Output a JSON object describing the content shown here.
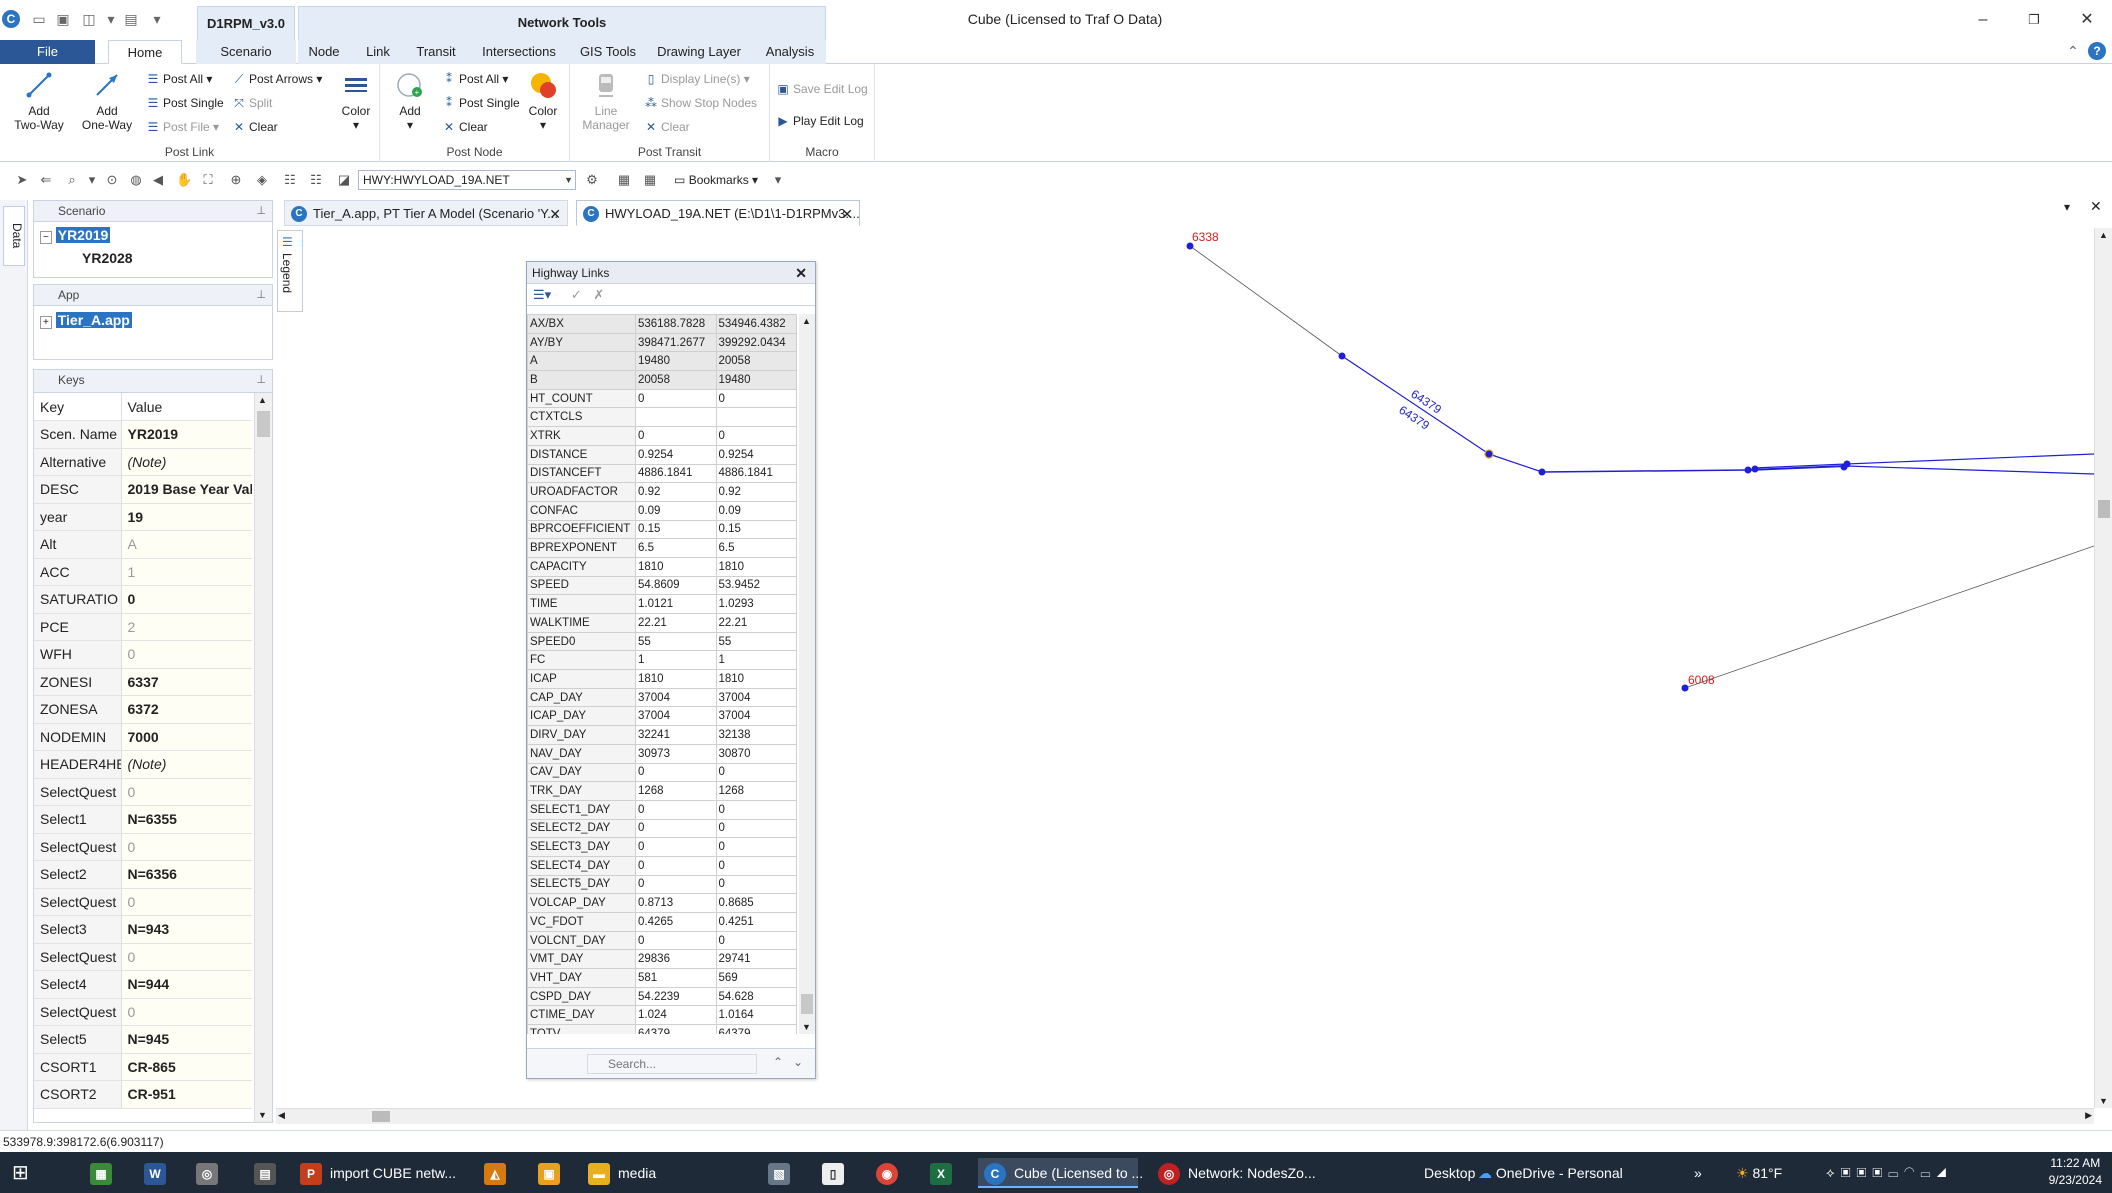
{
  "titlebar": {
    "context_tab": "D1RPM_v3.0",
    "network_tools": "Network Tools",
    "window_title": "Cube (Licensed to Traf O Data)"
  },
  "ribbon_tabs": [
    "File",
    "Home",
    "Scenario",
    "Node",
    "Link",
    "Transit",
    "Intersections",
    "GIS Tools",
    "Drawing Layer",
    "Analysis"
  ],
  "ribbon": {
    "add_two_way": "Add\nTwo-Way",
    "add_one_way": "Add\nOne-Way",
    "post_all": "Post All",
    "post_arrows": "Post Arrows",
    "post_single": "Post Single",
    "split": "Split",
    "post_file": "Post File",
    "clear": "Clear",
    "color": "Color",
    "post_link_label": "Post Link",
    "add": "Add",
    "node_post_all": "Post All",
    "node_post_single": "Post Single",
    "node_clear": "Clear",
    "node_color": "Color",
    "post_node_label": "Post Node",
    "line_manager": "Line\nManager",
    "display_lines": "Display Line(s)",
    "show_stop_nodes": "Show Stop Nodes",
    "transit_clear": "Clear",
    "post_transit_label": "Post Transit",
    "save_edit_log": "Save Edit Log",
    "play_edit_log": "Play Edit Log",
    "macro_label": "Macro"
  },
  "toolbar": {
    "layer": "HWY:HWYLOAD_19A.NET",
    "bookmarks": "Bookmarks"
  },
  "side_tabs": {
    "data": "Data",
    "legend": "Legend"
  },
  "scenario_panel": {
    "title": "Scenario",
    "items": [
      "YR2019",
      "YR2028"
    ]
  },
  "app_panel": {
    "title": "App",
    "items": [
      "Tier_A.app"
    ]
  },
  "keys_panel": {
    "title": "Keys",
    "header": [
      "Key",
      "Value"
    ],
    "rows": [
      {
        "key": "Scen. Name",
        "value": "YR2019",
        "style": "bold"
      },
      {
        "key": "Alternative",
        "value": "(Note)",
        "style": "ital"
      },
      {
        "key": "DESC",
        "value": "2019 Base Year Val",
        "style": "bold"
      },
      {
        "key": "year",
        "value": "19",
        "style": "bold"
      },
      {
        "key": "Alt",
        "value": "A",
        "style": "gray"
      },
      {
        "key": "ACC",
        "value": "1",
        "style": "gray"
      },
      {
        "key": "SATURATIO",
        "value": "0",
        "style": "bold"
      },
      {
        "key": "PCE",
        "value": "2",
        "style": "gray"
      },
      {
        "key": "WFH",
        "value": "0",
        "style": "gray"
      },
      {
        "key": "ZONESI",
        "value": "6337",
        "style": "bold"
      },
      {
        "key": "ZONESA",
        "value": "6372",
        "style": "bold"
      },
      {
        "key": "NODEMIN",
        "value": "7000",
        "style": "bold"
      },
      {
        "key": "HEADER4HE",
        "value": "(Note)",
        "style": "ital"
      },
      {
        "key": "SelectQuest",
        "value": "0",
        "style": "gray"
      },
      {
        "key": "Select1",
        "value": "N=6355",
        "style": "bold"
      },
      {
        "key": "SelectQuest",
        "value": "0",
        "style": "gray"
      },
      {
        "key": "Select2",
        "value": "N=6356",
        "style": "bold"
      },
      {
        "key": "SelectQuest",
        "value": "0",
        "style": "gray"
      },
      {
        "key": "Select3",
        "value": "N=943",
        "style": "bold"
      },
      {
        "key": "SelectQuest",
        "value": "0",
        "style": "gray"
      },
      {
        "key": "Select4",
        "value": "N=944",
        "style": "bold"
      },
      {
        "key": "SelectQuest",
        "value": "0",
        "style": "gray"
      },
      {
        "key": "Select5",
        "value": "N=945",
        "style": "bold"
      },
      {
        "key": "CSORT1",
        "value": "CR-865",
        "style": "bold"
      },
      {
        "key": "CSORT2",
        "value": "CR-951",
        "style": "bold"
      }
    ]
  },
  "doc_tabs": [
    {
      "label": "Tier_A.app, PT Tier A Model (Scenario 'Y..."
    },
    {
      "label": "HWYLOAD_19A.NET (E:\\D1\\1-D1RPMv3...."
    }
  ],
  "highway_links": {
    "title": "Highway Links",
    "search_placeholder": "Search...",
    "rows": [
      [
        "AX/BX",
        "536188.7828",
        "534946.4382"
      ],
      [
        "AY/BY",
        "398471.2677",
        "399292.0434"
      ],
      [
        "A",
        "19480",
        "20058"
      ],
      [
        "B",
        "20058",
        "19480"
      ],
      [
        "HT_COUNT",
        "0",
        "0"
      ],
      [
        "CTXTCLS",
        "",
        ""
      ],
      [
        "XTRK",
        "0",
        "0"
      ],
      [
        "DISTANCE",
        "0.9254",
        "0.9254"
      ],
      [
        "DISTANCEFT",
        "4886.1841",
        "4886.1841"
      ],
      [
        "UROADFACTOR",
        "0.92",
        "0.92"
      ],
      [
        "CONFAC",
        "0.09",
        "0.09"
      ],
      [
        "BPRCOEFFICIENT",
        "0.15",
        "0.15"
      ],
      [
        "BPREXPONENT",
        "6.5",
        "6.5"
      ],
      [
        "CAPACITY",
        "1810",
        "1810"
      ],
      [
        "SPEED",
        "54.8609",
        "53.9452"
      ],
      [
        "TIME",
        "1.0121",
        "1.0293"
      ],
      [
        "WALKTIME",
        "22.21",
        "22.21"
      ],
      [
        "SPEED0",
        "55",
        "55"
      ],
      [
        "FC",
        "1",
        "1"
      ],
      [
        "ICAP",
        "1810",
        "1810"
      ],
      [
        "CAP_DAY",
        "37004",
        "37004"
      ],
      [
        "ICAP_DAY",
        "37004",
        "37004"
      ],
      [
        "DIRV_DAY",
        "32241",
        "32138"
      ],
      [
        "NAV_DAY",
        "30973",
        "30870"
      ],
      [
        "CAV_DAY",
        "0",
        "0"
      ],
      [
        "TRK_DAY",
        "1268",
        "1268"
      ],
      [
        "SELECT1_DAY",
        "0",
        "0"
      ],
      [
        "SELECT2_DAY",
        "0",
        "0"
      ],
      [
        "SELECT3_DAY",
        "0",
        "0"
      ],
      [
        "SELECT4_DAY",
        "0",
        "0"
      ],
      [
        "SELECT5_DAY",
        "0",
        "0"
      ],
      [
        "VOLCAP_DAY",
        "0.8713",
        "0.8685"
      ],
      [
        "VC_FDOT",
        "0.4265",
        "0.4251"
      ],
      [
        "VOLCNT_DAY",
        "0",
        "0"
      ],
      [
        "VMT_DAY",
        "29836",
        "29741"
      ],
      [
        "VHT_DAY",
        "581",
        "569"
      ],
      [
        "CSPD_DAY",
        "54.2239",
        "54.628"
      ],
      [
        "CTIME_DAY",
        "1.024",
        "1.0164"
      ],
      [
        "TOTV",
        "64379",
        "64379"
      ]
    ]
  },
  "map_labels": {
    "node_top": "6338",
    "node_bottom": "6008",
    "link_label_1": "64379",
    "link_label_2": "64379"
  },
  "statusbar": "533978.9:398172.6(6.903117)",
  "taskbar": {
    "items": [
      "import CUBE netw...",
      "media",
      "Cube (Licensed to ...",
      "Network: NodesZo..."
    ],
    "desktop": "Desktop",
    "onedrive": "OneDrive - Personal",
    "temperature": "81°F",
    "time": "11:22 AM",
    "date": "9/23/2024"
  },
  "colors": {
    "accent": "#2b5797",
    "selection": "#2b74c2",
    "link_selected": "#1f1fd6",
    "node_label": "#d42020"
  }
}
